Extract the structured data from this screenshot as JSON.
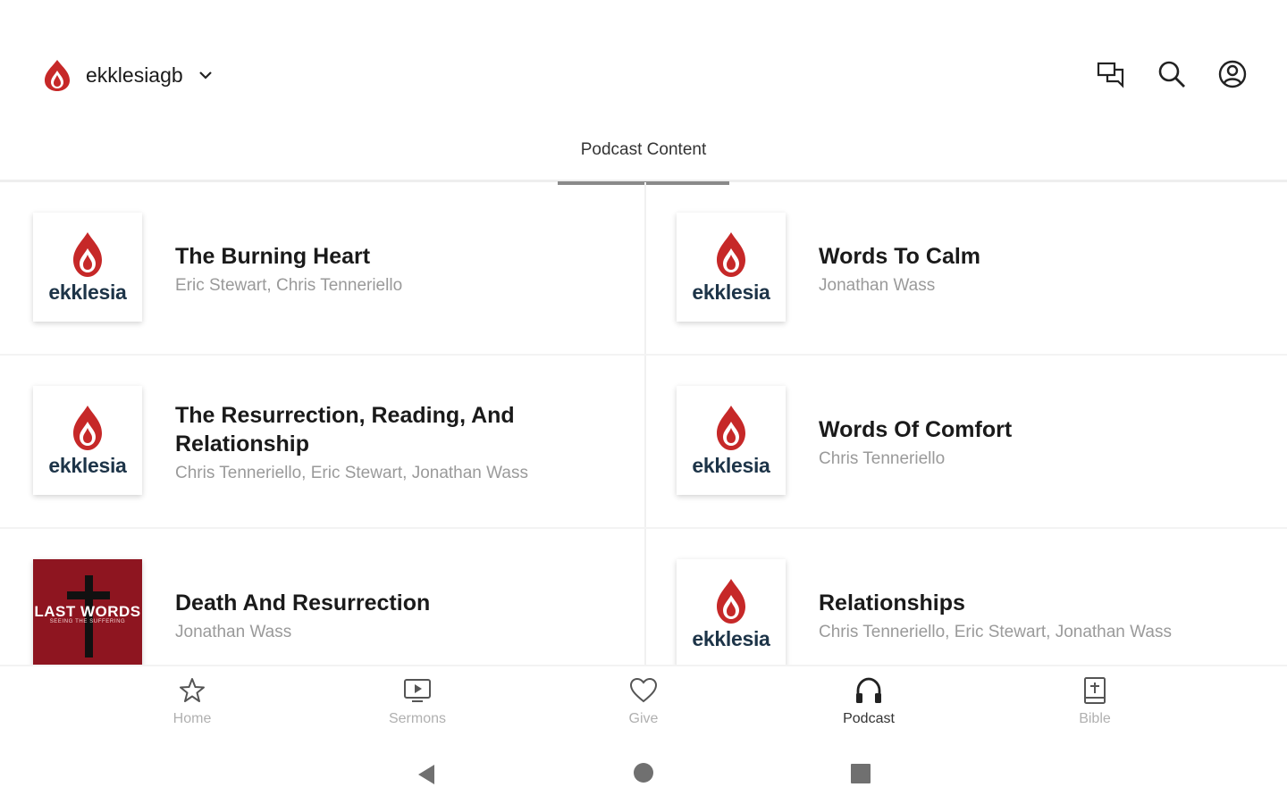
{
  "header": {
    "brand_name": "ekklesiagb",
    "icons": [
      "chat-icon",
      "search-icon",
      "account-icon"
    ]
  },
  "tabs": [
    {
      "label": "Podcast Content",
      "active": true
    }
  ],
  "thumb_word": "ekklesia",
  "items": [
    {
      "title": "The Burning Heart",
      "authors": "Eric Stewart, Chris Tenneriello"
    },
    {
      "title": "Words To Calm",
      "authors": "Jonathan Wass"
    },
    {
      "title": "The Resurrection, Reading, And Relationship",
      "authors": "Chris Tenneriello, Eric Stewart, Jonathan Wass"
    },
    {
      "title": "Words Of Comfort",
      "authors": "Chris Tenneriello"
    },
    {
      "title": "Death And Resurrection",
      "authors": "Jonathan Wass",
      "thumb_title": "LAST WORDS",
      "thumb_subtitle": "SEEING THE SUFFERING"
    },
    {
      "title": "Relationships",
      "authors": "Chris Tenneriello, Eric Stewart, Jonathan Wass"
    }
  ],
  "bottom_nav": [
    {
      "label": "Home",
      "icon": "star-icon"
    },
    {
      "label": "Sermons",
      "icon": "video-icon"
    },
    {
      "label": "Give",
      "icon": "heart-icon"
    },
    {
      "label": "Podcast",
      "icon": "headphones-icon",
      "active": true
    },
    {
      "label": "Bible",
      "icon": "bible-icon"
    }
  ],
  "colors": {
    "brand_red": "#c62828",
    "logo_text": "#1d3448",
    "accent_dark_red": "#8e1520",
    "muted_text": "#9a9a9a"
  }
}
